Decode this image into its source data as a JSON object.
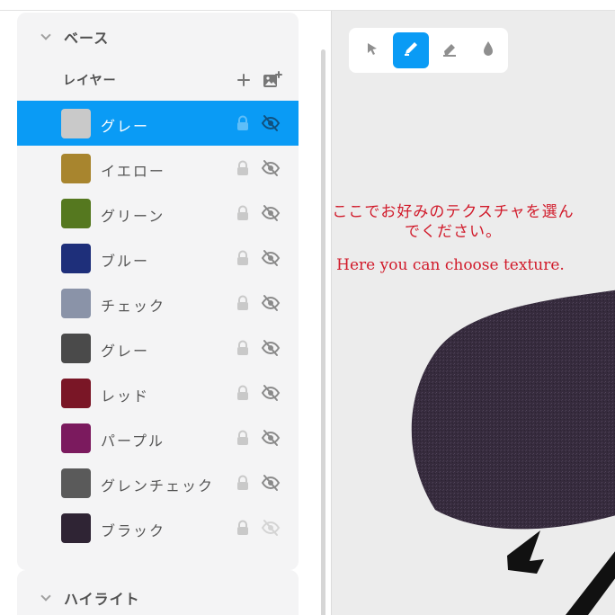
{
  "sidebar": {
    "base_section": {
      "title": "ベース"
    },
    "layer_header": {
      "label": "レイヤー",
      "add_icon": "plus-icon",
      "add_image_icon": "add-image-icon"
    },
    "layers": [
      {
        "name": "グレー",
        "swatch": "#c9c9c9",
        "selected": true,
        "visible": false
      },
      {
        "name": "イエロー",
        "swatch": "#a8852e",
        "selected": false,
        "visible": false
      },
      {
        "name": "グリーン",
        "swatch": "#55781f",
        "selected": false,
        "visible": false
      },
      {
        "name": "ブルー",
        "swatch": "#1e2f7a",
        "selected": false,
        "visible": false
      },
      {
        "name": "チェック",
        "swatch": "#8a93a8",
        "selected": false,
        "visible": false
      },
      {
        "name": "グレー",
        "swatch": "#4a4a4a",
        "selected": false,
        "visible": false
      },
      {
        "name": "レッド",
        "swatch": "#7a1626",
        "selected": false,
        "visible": false
      },
      {
        "name": "パープル",
        "swatch": "#7b1a5e",
        "selected": false,
        "visible": false
      },
      {
        "name": "グレンチェック",
        "swatch": "#5a5a5a",
        "selected": false,
        "visible": false
      },
      {
        "name": "ブラック",
        "swatch": "#2f2434",
        "selected": false,
        "visible": true
      }
    ],
    "highlight_section": {
      "title": "ハイライト"
    }
  },
  "toolbar": {
    "tools": [
      {
        "name": "select-tool",
        "icon": "cursor-arrow-icon",
        "active": false
      },
      {
        "name": "pen-tool",
        "icon": "pencil-icon",
        "active": true
      },
      {
        "name": "eraser-tool",
        "icon": "eraser-icon",
        "active": false
      },
      {
        "name": "fill-tool",
        "icon": "droplet-icon",
        "active": false
      }
    ]
  },
  "canvas": {
    "note_jp": "ここでお好みのテクスチャを選んでください。",
    "note_en": "Here you can choose texture.",
    "note_color": "#d11a2a",
    "fabric_color": "#362b3d"
  },
  "colors": {
    "accent": "#0a9bf5",
    "panel_bg": "#f4f4f5",
    "canvas_bg": "#ececec"
  }
}
